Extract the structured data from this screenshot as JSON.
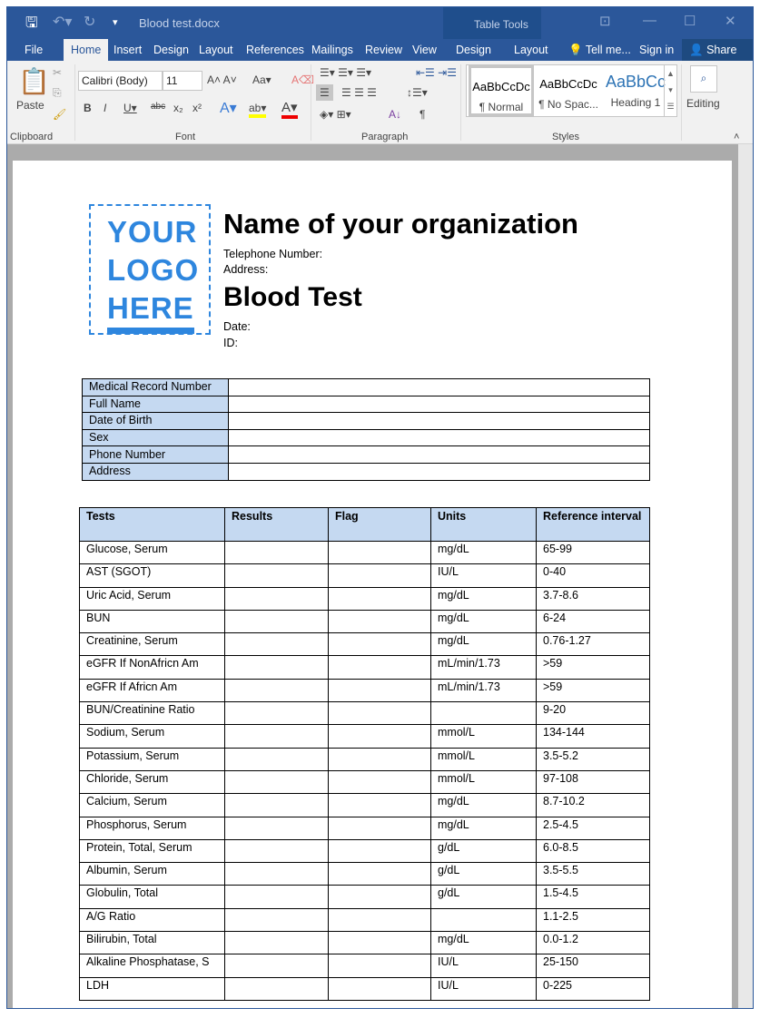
{
  "window": {
    "filename": "Blood test.docx",
    "context_tool": "Table Tools"
  },
  "tabs": [
    "File",
    "Home",
    "Insert",
    "Design",
    "Layout",
    "References",
    "Mailings",
    "Review",
    "View",
    "Design",
    "Layout"
  ],
  "tell_me": "Tell me...",
  "sign_in": "Sign in",
  "share": "Share",
  "ribbon": {
    "paste": "Paste",
    "font_name": "Calibri (Body)",
    "font_size": "11",
    "groups": [
      "Clipboard",
      "Font",
      "Paragraph",
      "Styles",
      "Editing"
    ],
    "styles": [
      {
        "preview": "AaBbCcDc",
        "label": "¶ Normal"
      },
      {
        "preview": "AaBbCcDc",
        "label": "¶ No Spac..."
      },
      {
        "preview": "AaBbCc",
        "label": "Heading 1"
      }
    ],
    "editing": "Editing"
  },
  "doc": {
    "logo": [
      "YOUR",
      "LOGO",
      "HERE"
    ],
    "org": "Name of your organization",
    "telephone": "Telephone Number:",
    "address": "Address:",
    "title": "Blood Test",
    "date": "Date:",
    "id": "ID:",
    "info_rows": [
      "Medical Record Number",
      "Full Name",
      "Date of Birth",
      "Sex",
      "Phone Number",
      "Address"
    ],
    "test_headers": [
      "Tests",
      "Results",
      "Flag",
      "Units",
      "Reference interval"
    ],
    "tests": [
      [
        "Glucose, Serum",
        "mg/dL",
        "65-99"
      ],
      [
        "AST (SGOT)",
        "IU/L",
        "0-40"
      ],
      [
        "Uric Acid, Serum",
        "mg/dL",
        "3.7-8.6"
      ],
      [
        "BUN",
        "mg/dL",
        "6-24"
      ],
      [
        "Creatinine, Serum",
        "mg/dL",
        "0.76-1.27"
      ],
      [
        "eGFR If NonAfricn Am",
        "mL/min/1.73",
        ">59"
      ],
      [
        "eGFR If Africn Am",
        "mL/min/1.73",
        ">59"
      ],
      [
        "BUN/Creatinine Ratio",
        "",
        "9-20"
      ],
      [
        "Sodium, Serum",
        "mmol/L",
        "134-144"
      ],
      [
        "Potassium, Serum",
        "mmol/L",
        "3.5-5.2"
      ],
      [
        "Chloride, Serum",
        "mmol/L",
        "97-108"
      ],
      [
        "Calcium, Serum",
        "mg/dL",
        "8.7-10.2"
      ],
      [
        "Phosphorus, Serum",
        "mg/dL",
        "2.5-4.5"
      ],
      [
        "Protein, Total, Serum",
        "g/dL",
        "6.0-8.5"
      ],
      [
        "Albumin, Serum",
        "g/dL",
        "3.5-5.5"
      ],
      [
        "Globulin, Total",
        "g/dL",
        "1.5-4.5"
      ],
      [
        "A/G Ratio",
        "",
        "1.1-2.5"
      ],
      [
        "Bilirubin, Total",
        "mg/dL",
        "0.0-1.2"
      ],
      [
        "Alkaline Phosphatase, S",
        "IU/L",
        "25-150"
      ],
      [
        "LDH",
        "IU/L",
        "0-225"
      ]
    ]
  }
}
